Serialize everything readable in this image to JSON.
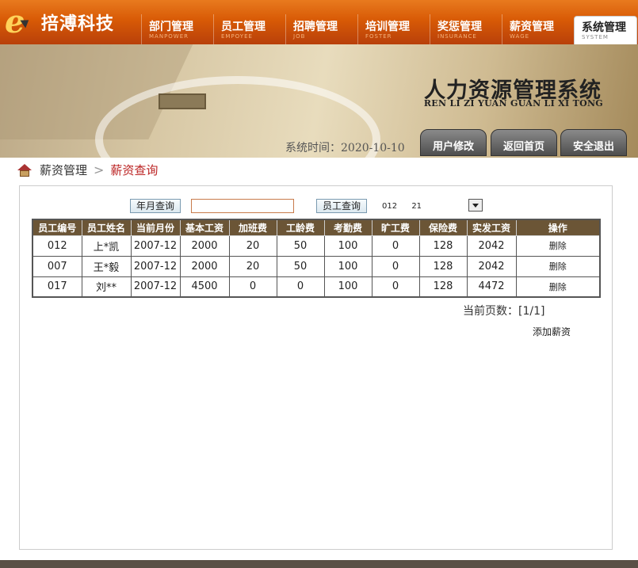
{
  "brand": {
    "letter": "e",
    "name": "掊溥科技"
  },
  "nav": [
    {
      "cn": "部门管理",
      "en": "MANPOWER",
      "active": false
    },
    {
      "cn": "员工管理",
      "en": "EMPOYEE",
      "active": false
    },
    {
      "cn": "招聘管理",
      "en": "JOB",
      "active": false
    },
    {
      "cn": "培训管理",
      "en": "FOSTER",
      "active": false
    },
    {
      "cn": "奖惩管理",
      "en": "INSURANCE",
      "active": false
    },
    {
      "cn": "薪资管理",
      "en": "WAGE",
      "active": false
    },
    {
      "cn": "系统管理",
      "en": "SYSTEM",
      "active": true
    }
  ],
  "banner": {
    "title": "人力资源管理系统",
    "subtitle": "REN LI ZI YUAN GUAN LI XI TONG",
    "system_time": "系统时间：2020-10-10",
    "buttons": {
      "user_edit": "用户修改",
      "home": "返回首页",
      "logout": "安全退出"
    }
  },
  "breadcrumb": {
    "parent": "薪资管理",
    "separator": ">",
    "current": "薪资查询"
  },
  "search": {
    "month_button": "年月查询",
    "month_input_value": "",
    "employee_button": "员工查询",
    "employee_id": "012",
    "employee_num": "21"
  },
  "table": {
    "headers": [
      "员工编号",
      "员工姓名",
      "当前月份",
      "基本工资",
      "加班费",
      "工龄费",
      "考勤费",
      "旷工费",
      "保险费",
      "实发工资",
      "操作"
    ],
    "rows": [
      [
        "012",
        "上*凯",
        "2007-12",
        "2000",
        "20",
        "50",
        "100",
        "0",
        "128",
        "2042",
        "删除"
      ],
      [
        "007",
        "王*毅",
        "2007-12",
        "2000",
        "20",
        "50",
        "100",
        "0",
        "128",
        "2042",
        "删除"
      ],
      [
        "017",
        "刘**",
        "2007-12",
        "4500",
        "0",
        "0",
        "100",
        "0",
        "128",
        "4472",
        "删除"
      ]
    ]
  },
  "pager": "当前页数：[1/1]",
  "add_link": "添加薪资",
  "colors": {
    "nav_orange": "#d85a06",
    "table_header": "#6b5536",
    "breadcrumb_current": "#bb2222"
  }
}
